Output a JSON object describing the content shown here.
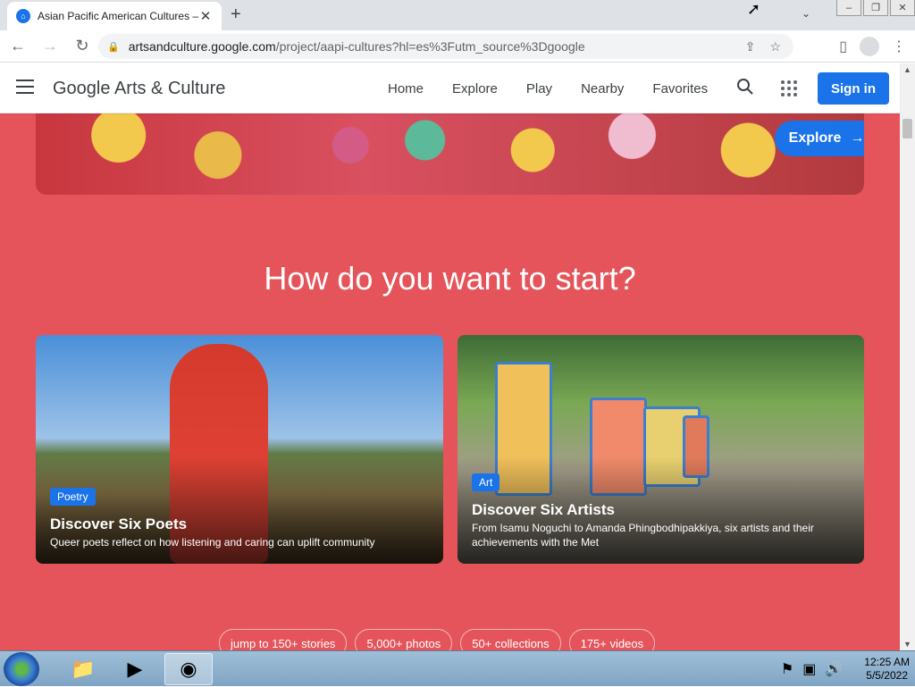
{
  "browser": {
    "tab_title": "Asian Pacific American Cultures –",
    "url_host": "artsandculture.google.com",
    "url_path": "/project/aapi-cultures?hl=es%3Futm_source%3Dgoogle"
  },
  "site": {
    "logo": "Google Arts & Culture",
    "nav": [
      "Home",
      "Explore",
      "Play",
      "Nearby",
      "Favorites"
    ],
    "signin_label": "Sign in"
  },
  "banner": {
    "explore_label": "Explore"
  },
  "section": {
    "heading": "How do you want to start?"
  },
  "cards": [
    {
      "tag": "Poetry",
      "title": "Discover Six Poets",
      "desc": "Queer poets reflect on how listening and caring can uplift community"
    },
    {
      "tag": "Art",
      "title": "Discover Six Artists",
      "desc": "From Isamu Noguchi to Amanda Phingbodhipakkiya, six artists and their achievements with the Met"
    }
  ],
  "pills": [
    "jump to 150+ stories",
    "5,000+ photos",
    "50+ collections",
    "175+ videos"
  ],
  "taskbar": {
    "time": "12:25 AM",
    "date": "5/5/2022"
  },
  "colors": {
    "page_bg": "#e4545a",
    "accent": "#1a73e8"
  }
}
